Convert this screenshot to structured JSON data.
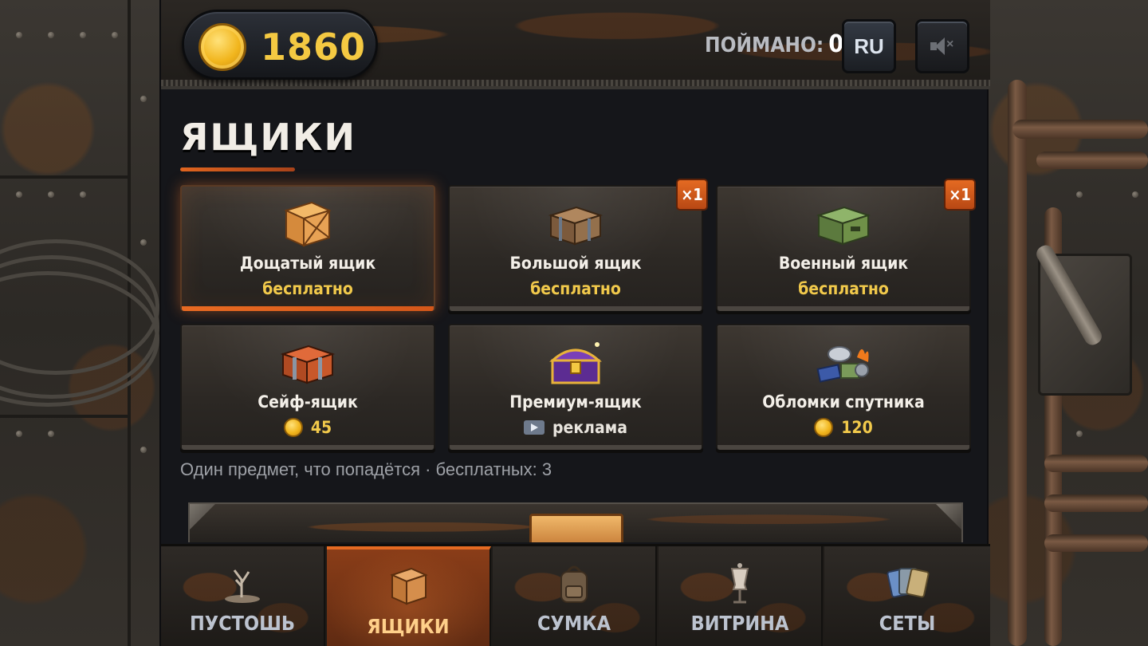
{
  "header": {
    "coins": "1860",
    "caught_label": "ПОЙМАНО:",
    "caught_value": "0",
    "language": "RU"
  },
  "section": {
    "title": "ЯЩИКИ"
  },
  "boxes": [
    {
      "name": "Дощатый ящик",
      "price": "бесплатно",
      "badge": "",
      "selected": true,
      "icon": "wooden-crate-icon"
    },
    {
      "name": "Большой ящик",
      "price": "бесплатно",
      "badge": "×1",
      "selected": false,
      "icon": "big-crate-icon"
    },
    {
      "name": "Военный ящик",
      "price": "бесплатно",
      "badge": "×1",
      "selected": false,
      "icon": "military-crate-icon"
    },
    {
      "name": "Сейф-ящик",
      "price": "45",
      "badge": "",
      "selected": false,
      "icon": "safe-crate-icon"
    },
    {
      "name": "Премиум-ящик",
      "price": "реклама",
      "badge": "",
      "selected": false,
      "icon": "premium-chest-icon"
    },
    {
      "name": "Обломки спутника",
      "price": "120",
      "badge": "",
      "selected": false,
      "icon": "satellite-debris-icon"
    }
  ],
  "hint": "Один предмет, что попадётся · бесплатных: 3",
  "nav": [
    {
      "label": "ПУСТОШЬ",
      "icon": "dead-tree-icon",
      "active": false
    },
    {
      "label": "ЯЩИКИ",
      "icon": "crate-icon",
      "active": true
    },
    {
      "label": "СУМКА",
      "icon": "backpack-icon",
      "active": false
    },
    {
      "label": "ВИТРИНА",
      "icon": "mannequin-icon",
      "active": false
    },
    {
      "label": "СЕТЫ",
      "icon": "cards-icon",
      "active": false
    }
  ],
  "colors": {
    "accent": "#e46a22",
    "gold": "#f4c942",
    "panel": "#15161a"
  }
}
